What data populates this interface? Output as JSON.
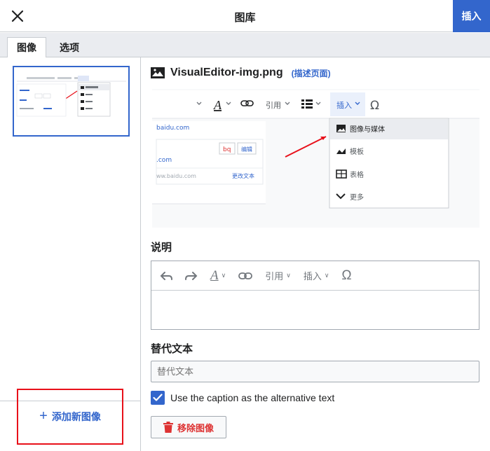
{
  "header": {
    "title": "图库",
    "insert_label": "插入"
  },
  "tabs": [
    {
      "label": "图像",
      "active": true
    },
    {
      "label": "选项",
      "active": false
    }
  ],
  "sidebar": {
    "add_label": "添加新图像"
  },
  "file": {
    "name": "VisualEditor-img.png",
    "description_link": "(描述页面)"
  },
  "preview": {
    "toolbar": {
      "cite": "引用",
      "insert": "插入"
    },
    "menu": [
      "图像与媒体",
      "模板",
      "表格",
      "更多"
    ],
    "doc": {
      "link1": "baidu.com",
      "btn1": "bq",
      "btn2": "编辑",
      "link2": ".com",
      "link3": "ww.baidu.com",
      "link4": "更改文本"
    }
  },
  "caption": {
    "label": "说明",
    "toolbar": {
      "cite": "引用",
      "insert": "插入"
    },
    "value": ""
  },
  "alt_text": {
    "label": "替代文本",
    "placeholder": "替代文本",
    "value": ""
  },
  "checkbox": {
    "label": "Use the caption as the alternative text",
    "checked": true
  },
  "remove": {
    "label": "移除图像"
  },
  "colors": {
    "accent": "#3366cc",
    "destructive": "#d33333",
    "highlight": "#e8101a"
  }
}
